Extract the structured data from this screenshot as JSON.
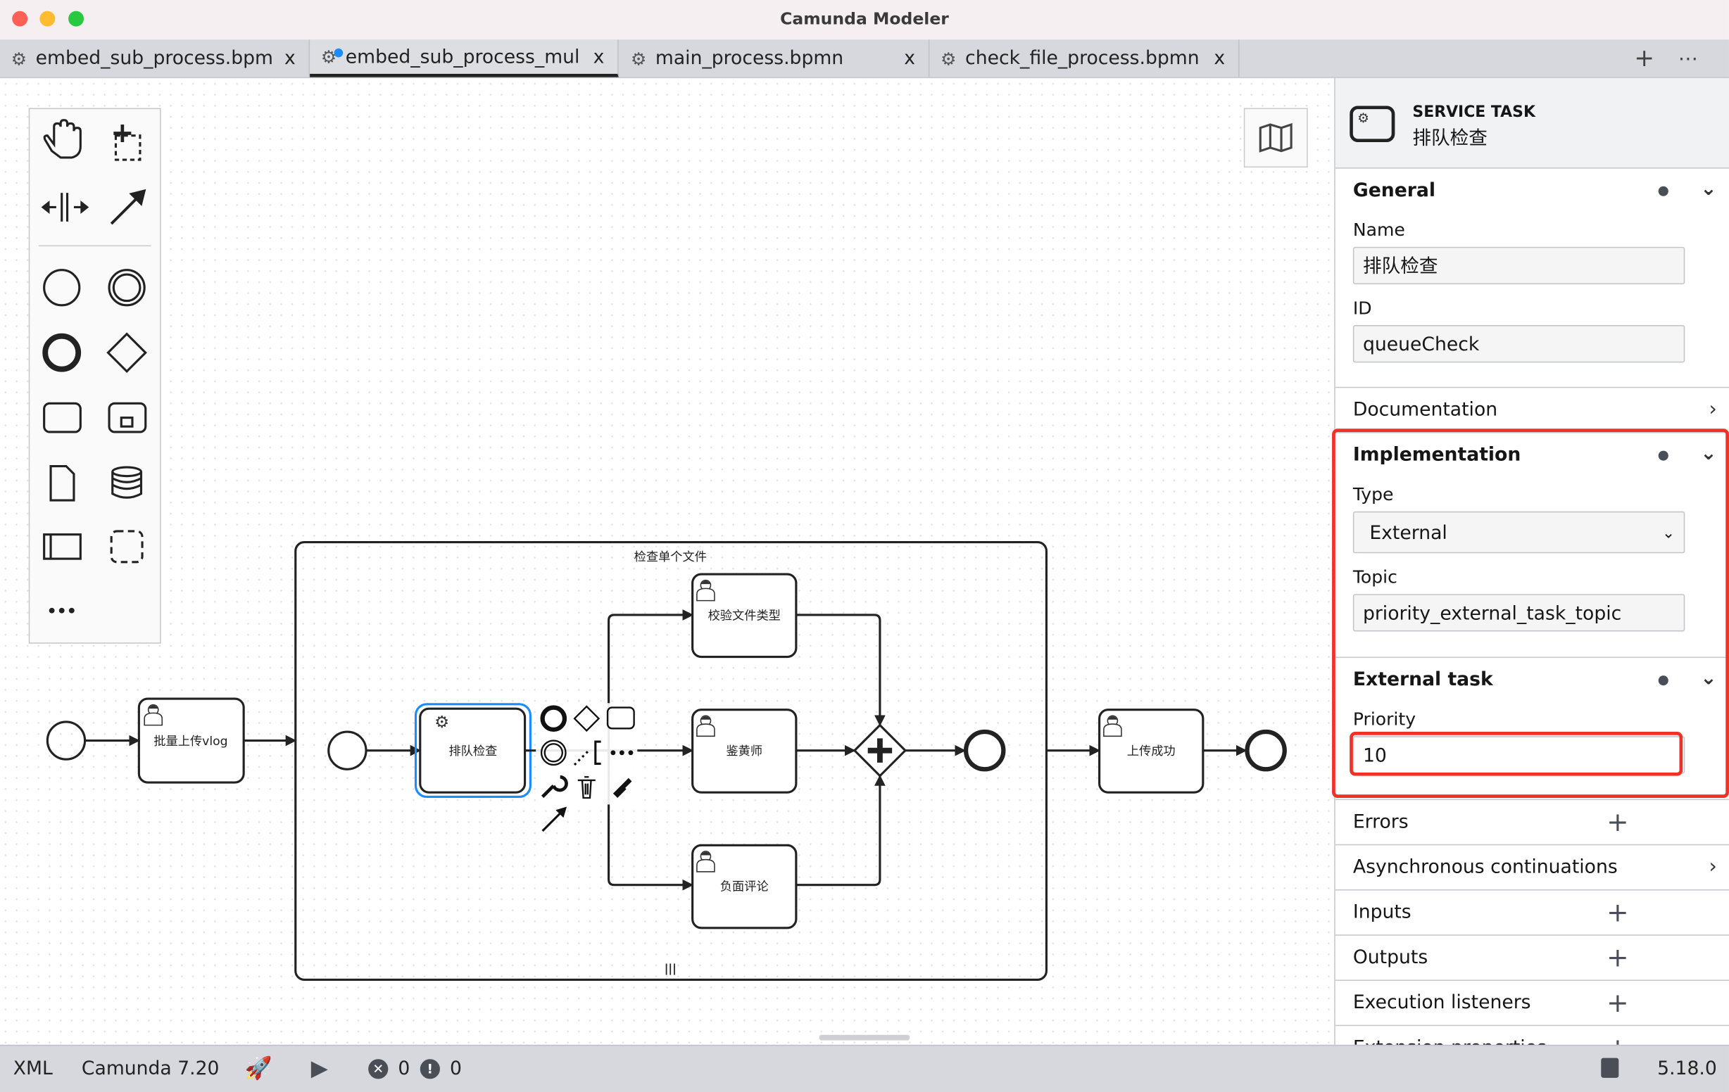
{
  "window": {
    "title": "Camunda Modeler"
  },
  "tabs": [
    {
      "label": "embed_sub_process.bpm",
      "close": "x",
      "icon": "gear-icon"
    },
    {
      "label": "embed_sub_process_mul",
      "close": "x",
      "icon": "gear-icon",
      "unsaved": true,
      "active": true
    },
    {
      "label": "main_process.bpmn",
      "close": "x",
      "icon": "gear-icon"
    },
    {
      "label": "check_file_process.bpmn",
      "close": "x",
      "icon": "gear-icon"
    }
  ],
  "tab_actions": {
    "add": "+",
    "more": "⋯"
  },
  "diagram": {
    "tasks": {
      "upload": "批量上传vlog",
      "queue": "排队检查",
      "verify": "校验文件类型",
      "porn": "鉴黄师",
      "negative": "负面评论",
      "success": "上传成功"
    },
    "subprocess_label": "检查单个文件",
    "multi_instance_marker": "|||"
  },
  "properties": {
    "header": {
      "type": "SERVICE TASK",
      "name": "排队检查"
    },
    "general": {
      "title": "General",
      "name_label": "Name",
      "name_value": "排队检查",
      "id_label": "ID",
      "id_value": "queueCheck"
    },
    "documentation": "Documentation",
    "implementation": {
      "title": "Implementation",
      "type_label": "Type",
      "type_value": "External",
      "topic_label": "Topic",
      "topic_value": "priority_external_task_topic"
    },
    "external_task": {
      "title": "External task",
      "priority_label": "Priority",
      "priority_value": "10"
    },
    "groups": [
      "Errors",
      "Asynchronous continuations",
      "Inputs",
      "Outputs",
      "Execution listeners",
      "Extension properties"
    ]
  },
  "status": {
    "xml": "XML",
    "engine": "Camunda 7.20",
    "errors": "0",
    "warnings": "0",
    "version": "5.18.0"
  },
  "colors": {
    "selection": "#1a8cff",
    "highlight": "#f03226",
    "accent_dot": "#1a8cff"
  }
}
